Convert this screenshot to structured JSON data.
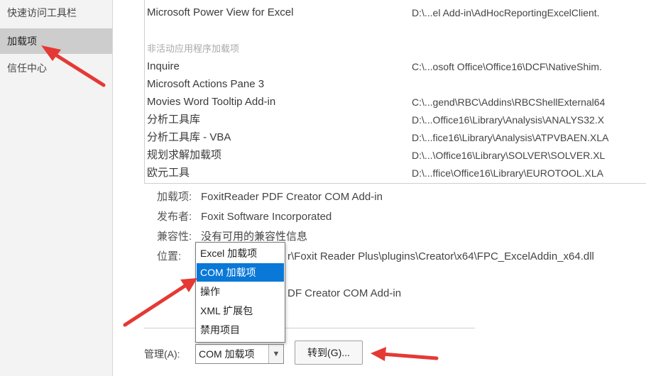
{
  "sidebar": {
    "items": [
      {
        "label": "快速访问工具栏",
        "active": false
      },
      {
        "label": "加载项",
        "active": true
      },
      {
        "label": "信任中心",
        "active": false
      }
    ]
  },
  "addins": {
    "active_partial": [
      {
        "name": "Microsoft Power View for Excel",
        "path": "D:\\...el Add-in\\AdHocReportingExcelClient."
      }
    ],
    "inactive_header": "非活动应用程序加载项",
    "inactive": [
      {
        "name": "Inquire",
        "path": "C:\\...osoft Office\\Office16\\DCF\\NativeShim."
      },
      {
        "name": "Microsoft Actions Pane 3",
        "path": ""
      },
      {
        "name": "Movies Word Tooltip Add-in",
        "path": "C:\\...gend\\RBC\\Addins\\RBCShellExternal64"
      },
      {
        "name": "分析工具库",
        "path": "D:\\...Office16\\Library\\Analysis\\ANALYS32.X"
      },
      {
        "name": "分析工具库 - VBA",
        "path": "D:\\...fice16\\Library\\Analysis\\ATPVBAEN.XLA"
      },
      {
        "name": "规划求解加载项",
        "path": "D:\\...\\Office16\\Library\\SOLVER\\SOLVER.XL"
      },
      {
        "name": "欧元工具",
        "path": "D:\\...ffice\\Office16\\Library\\EUROTOOL.XLA"
      }
    ]
  },
  "details": {
    "addin_label": "加载项:",
    "addin_value": "FoxitReader PDF Creator COM Add-in",
    "publisher_label": "发布者:",
    "publisher_value": "Foxit Software Incorporated",
    "compat_label": "兼容性:",
    "compat_value": "没有可用的兼容性信息",
    "location_label": "位置:",
    "location_value": "r\\Foxit Reader Plus\\plugins\\Creator\\x64\\FPC_ExcelAddin_x64.dll",
    "desc_value": "DF Creator COM Add-in"
  },
  "manage": {
    "label": "管理(A):",
    "selected": "COM 加载项",
    "go_label": "转到(G)..."
  },
  "dropdown": {
    "options": [
      "Excel 加载项",
      "COM 加载项",
      "操作",
      "XML 扩展包",
      "禁用项目"
    ],
    "selected_index": 1
  },
  "colors": {
    "accent": "#0a78d7",
    "annotation_arrow": "#e53935",
    "sidebar_bg": "#f3f3f3",
    "sidebar_active": "#cdcdcd"
  }
}
